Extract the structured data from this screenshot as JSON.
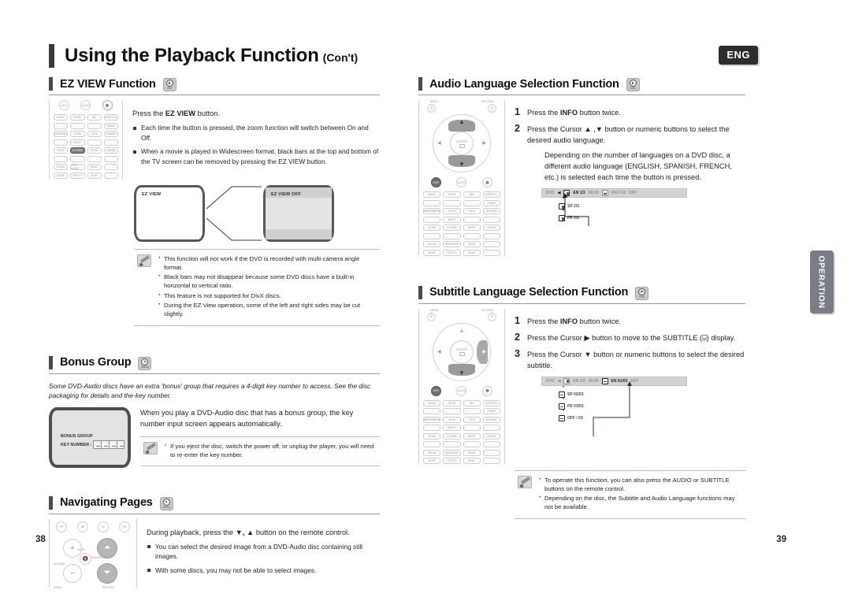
{
  "header": {
    "title": "Using the Playback Function",
    "subtitle": "(Con't)",
    "lang_badge": "ENG"
  },
  "side_tab": {
    "label": "OPERATION"
  },
  "pages": {
    "left": "38",
    "right": "39"
  },
  "sections": {
    "ez_view": {
      "title": "EZ VIEW Function",
      "lead_pre": "Press the ",
      "lead_bold": "EZ VIEW",
      "lead_post": " button.",
      "bullets": [
        "Each time the button is pressed, the zoom function will switch between On and Off.",
        "When a movie is played in Widescreen format, black bars at the top and bottom of the TV screen can be removed by pressing the EZ VIEW button."
      ],
      "tv_on_label": "EZ VIEW",
      "tv_off_label": "EZ VIEW OFF",
      "notes": [
        "This function will not work if the DVD is recorded with multi-camera angle format.",
        "Black bars may not disappear because some DVD discs have a built-in horizontal to vertical ratio.",
        "This feature is not supported for DivX discs.",
        "During the EZ View operation, some of the left and right sides may be cut slightly."
      ],
      "remote_keys": [
        "MUSIC",
        "MOVIE",
        "ABC",
        "SUPER 5.1",
        "",
        "",
        "",
        "P.BASS",
        "DIMMER/MEMORY",
        "SLOW",
        "LOGO",
        "STANDBY",
        "",
        "MO/ST",
        "",
        "",
        "ZOOM",
        "EZ VIEW",
        "SLEEP",
        "CANCEL",
        "",
        "",
        "",
        "",
        "P.SCAN",
        "REM AUDIO",
        "DEMO",
        "",
        "MODE",
        "EFFECT",
        "BLUE",
        ""
      ],
      "remote_top_circles": [
        "INFO",
        "AUDIO",
        "MUTE"
      ]
    },
    "bonus_group": {
      "title": "Bonus Group",
      "intro": "Some DVD-Audio discs have an extra 'bonus' group that requires a 4-digit key number to access. See the disc packaging for details and the-key number.",
      "body": "When you play a DVD-Audio disc that has a bonus group, the key number input screen appears automatically.",
      "screen_title": "BONUS GROUP",
      "screen_key_label": "KEY NUMBER :",
      "screen_boxes": [
        "_",
        "_",
        "_",
        "_"
      ],
      "notes": [
        "If you eject the disc, switch the power off, or unplug the player, you will need to re-enter the key number."
      ]
    },
    "navigating_pages": {
      "title": "Navigating Pages",
      "lead_pre": "During playback, press the ",
      "lead_keys": "▼, ▲",
      "lead_post": " button on the remote control.",
      "bullets": [
        "You can select the desired image from a DVD-Audio disc containing still images.",
        "With some discs, you may not be able to select images."
      ],
      "remote_labels": {
        "volume": "VOLUME",
        "mute": "MUTE",
        "tuning": "TUNING/CH",
        "menu": "MENU",
        "return": "RETURN"
      }
    },
    "audio_language": {
      "title": "Audio Language Selection Function",
      "steps": [
        {
          "n": "1",
          "pre": "Press the ",
          "bold": "INFO",
          "post": " button twice."
        },
        {
          "n": "2",
          "pre": "Press the Cursor ▲ ,▼ button or numeric buttons to select the desired audio language.",
          "bold": "",
          "post": ""
        }
      ],
      "subnote": "Depending on the number of languages on a DVD disc, a different audio language (ENGLISH, SPANISH, FRENCH, etc.) is selected each time the button is pressed.",
      "osd_bar": {
        "disc": "DVD",
        "cursor": "◀",
        "current": "EN 1/3",
        "dim1": "00:00",
        "dim2": "OFF/ 03",
        "dim3": "OFF"
      },
      "osd_chain": [
        "SP 2/3",
        "FR 3/3"
      ],
      "remote_labels": {
        "menu": "MENU",
        "return": "RETURN",
        "enter": "ENTER"
      }
    },
    "subtitle_language": {
      "title": "Subtitle Language Selection Function",
      "steps": [
        {
          "n": "1",
          "pre": "Press the ",
          "bold": "INFO",
          "post": " button twice."
        },
        {
          "n": "2",
          "pre": "Press the Cursor ▶ button to move to the SUBTITLE (⌸) display.",
          "bold": "",
          "post": ""
        },
        {
          "n": "3",
          "pre": "Press the Cursor ▼ button or numeric buttons to select the desired subtitle.",
          "bold": "",
          "post": ""
        }
      ],
      "osd_bar": {
        "disc": "DVD",
        "cursor": "◀",
        "dim_audio": "EN 1/3",
        "dim_time": "00:00",
        "current": "EN 01/03",
        "dim_end": "OFF"
      },
      "osd_chain": [
        "SP 02/03",
        "FR 03/03",
        "OFF / 03"
      ],
      "notes": [
        "To operate this function, you can also press the AUDIO or SUBTITLE buttons on the remote control.",
        "Depending on the disc, the Subtitle and Audio Language functions may not be available."
      ]
    }
  }
}
